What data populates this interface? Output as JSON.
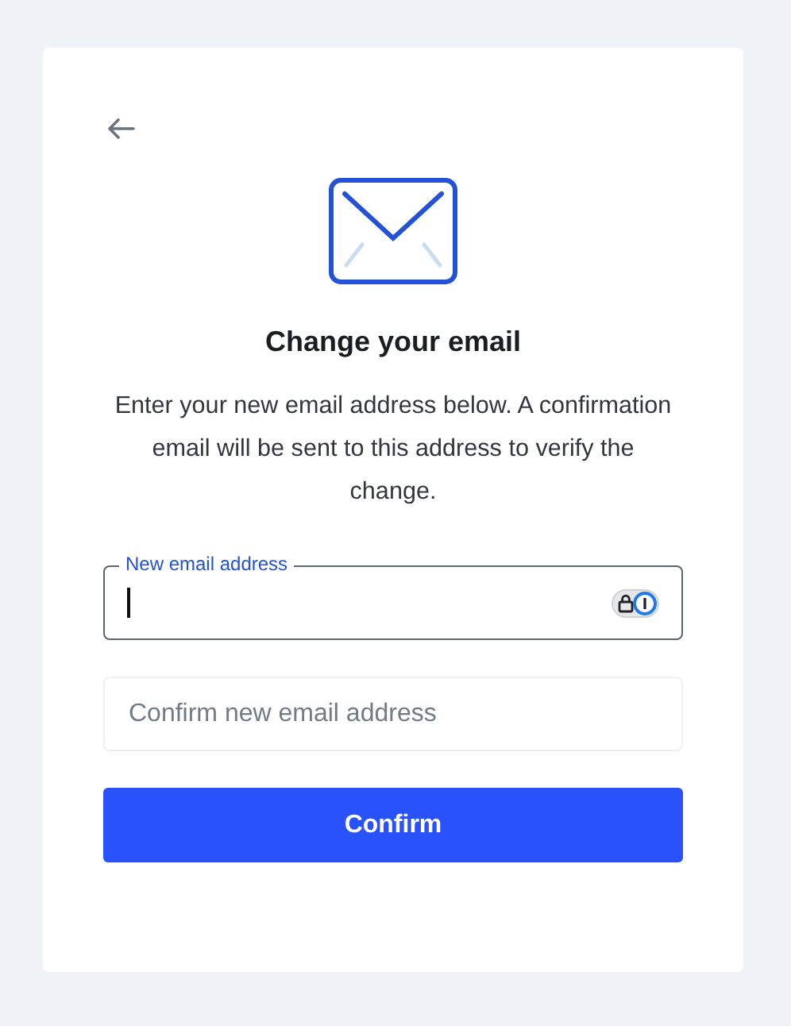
{
  "title": "Change your email",
  "description": "Enter your new email address below. A confirmation email will be sent to this address to verify the change.",
  "fields": [
    {
      "label": "New email address",
      "focused": true
    },
    {
      "placeholder": "Confirm new email address",
      "focused": false
    }
  ],
  "button": "Confirm"
}
